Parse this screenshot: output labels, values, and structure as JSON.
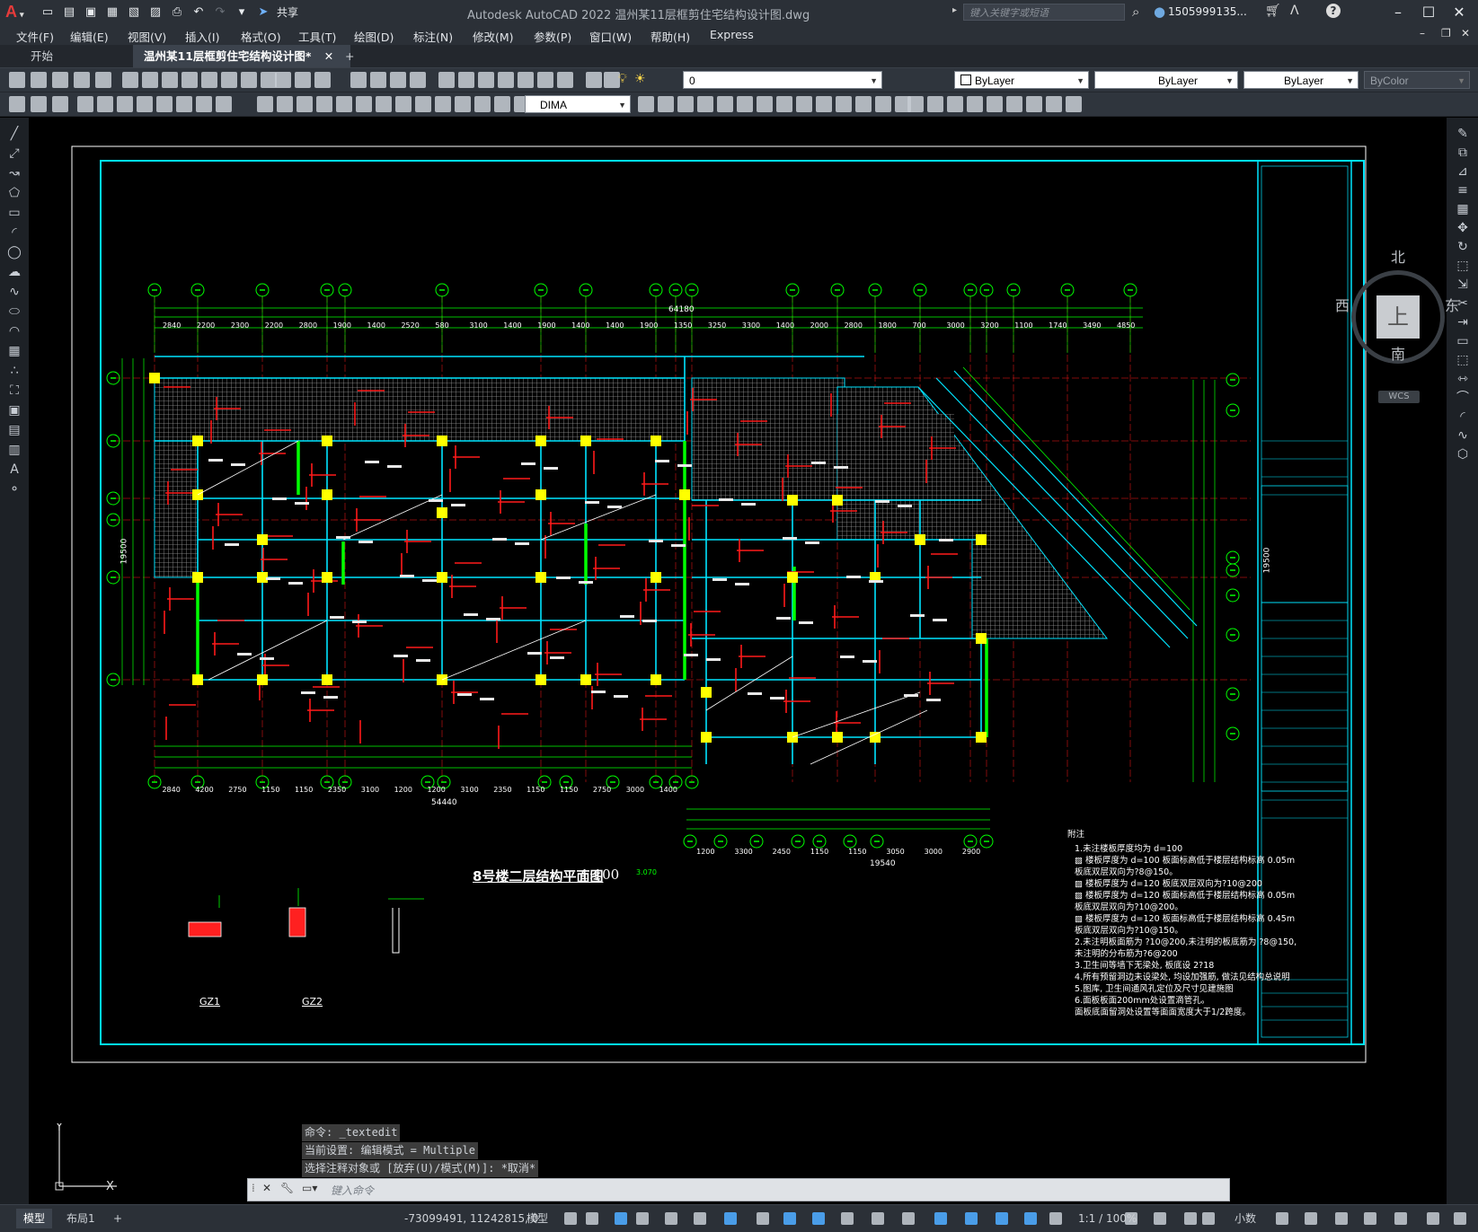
{
  "app": {
    "logo_letter": "A",
    "title": "Autodesk AutoCAD 2022    温州某11层框剪住宅结构设计图.dwg",
    "share_label": "共享",
    "search_placeholder": "键入关键字或短语",
    "user": "1505999135..."
  },
  "menu": [
    "文件(F)",
    "编辑(E)",
    "视图(V)",
    "插入(I)",
    "格式(O)",
    "工具(T)",
    "绘图(D)",
    "标注(N)",
    "修改(M)",
    "参数(P)",
    "窗口(W)",
    "帮助(H)",
    "Express"
  ],
  "tabs": {
    "start": "开始",
    "active": "温州某11层框剪住宅结构设计图*",
    "add": "+"
  },
  "toolbar": {
    "layer_value": "0",
    "color_value": "ByLayer",
    "linetype_value": "ByLayer",
    "lineweight_value": "ByLayer",
    "plotstyle_value": "ByColor",
    "dimstyle_value": "DIMA"
  },
  "viewcube": {
    "north": "北",
    "south": "南",
    "west": "西",
    "east": "东",
    "top": "上",
    "wcs": "WCS"
  },
  "drawing": {
    "plan_title": "8号楼二层结构平面图",
    "plan_scale": "1:100",
    "elevation_mark": "3.070",
    "overall_dim_top": "64180",
    "overall_dim_bottom": "54440",
    "overall_dim_bottom2": "19540",
    "overall_dim_right": "19500",
    "top_dims": [
      "2840",
      "2200",
      "2300",
      "2200",
      "2800",
      "1900",
      "1400",
      "2520",
      "580",
      "3100",
      "1400",
      "1900",
      "1400",
      "1400",
      "1900",
      "1350",
      "3250",
      "3300",
      "1400",
      "2000",
      "2800",
      "1800",
      "700",
      "3000",
      "3200",
      "1100",
      "1740",
      "3490",
      "4850"
    ],
    "bottom_dims": [
      "2840",
      "4200",
      "2750",
      "1150",
      "1150",
      "2350",
      "3100",
      "1200",
      "1200",
      "3100",
      "2350",
      "1150",
      "1150",
      "2750",
      "3000",
      "1400"
    ],
    "bottom_dims2": [
      "1200",
      "3300",
      "2450",
      "1150",
      "1150",
      "3050",
      "3000",
      "2900"
    ],
    "details": [
      "GZ1",
      "GZ2"
    ],
    "notes_title": "附注",
    "notes": [
      "1.未注楼板厚度均为 d=100",
      "  ▨ 楼板厚度为 d=100 板面标高低于楼层结构标高 0.05m",
      "  板底双层双向为?8@150。",
      "  ▨ 楼板厚度为 d=120 板底双层双向为?10@200",
      "  ▨ 楼板厚度为 d=120 板面标高低于楼层结构标高 0.05m",
      "  板底双层双向为?10@200。",
      "  ▨ 楼板厚度为 d=120 板面标高低于楼层结构标高 0.45m",
      "  板底双层双向为?10@150。",
      "2.未注明板面筋为 ?10@200,未注明的板底筋为 ?8@150,",
      "  未注明的分布筋为?6@200",
      "3.卫生间等墙下无梁处, 板底设 2?18",
      "4.所有预留洞边未设梁处, 均设加强筋, 做法见结构总说明",
      "5.图库, 卫生间通风孔定位及尺寸见建施图",
      "6.面板板面200mm处设置滴管孔。",
      "  面板底面留洞处设置等面面宽度大于1/2跨度。"
    ]
  },
  "command": {
    "history": [
      "命令: _textedit",
      "当前设置: 编辑模式 = Multiple",
      "选择注释对象或 [放弃(U)/模式(M)]: *取消*"
    ],
    "placeholder": "键入命令"
  },
  "status": {
    "tab_model": "模型",
    "tab_layout": "布局1",
    "coords": "-73099491, 11242815, 0",
    "space": "模型",
    "scale": "1:1 / 100%",
    "units": "小数"
  },
  "colors": {
    "cyan": "#00e5ff",
    "green": "#00ff00",
    "red": "#ff1a1a",
    "yellow": "#ffff00",
    "white": "#ffffff"
  }
}
